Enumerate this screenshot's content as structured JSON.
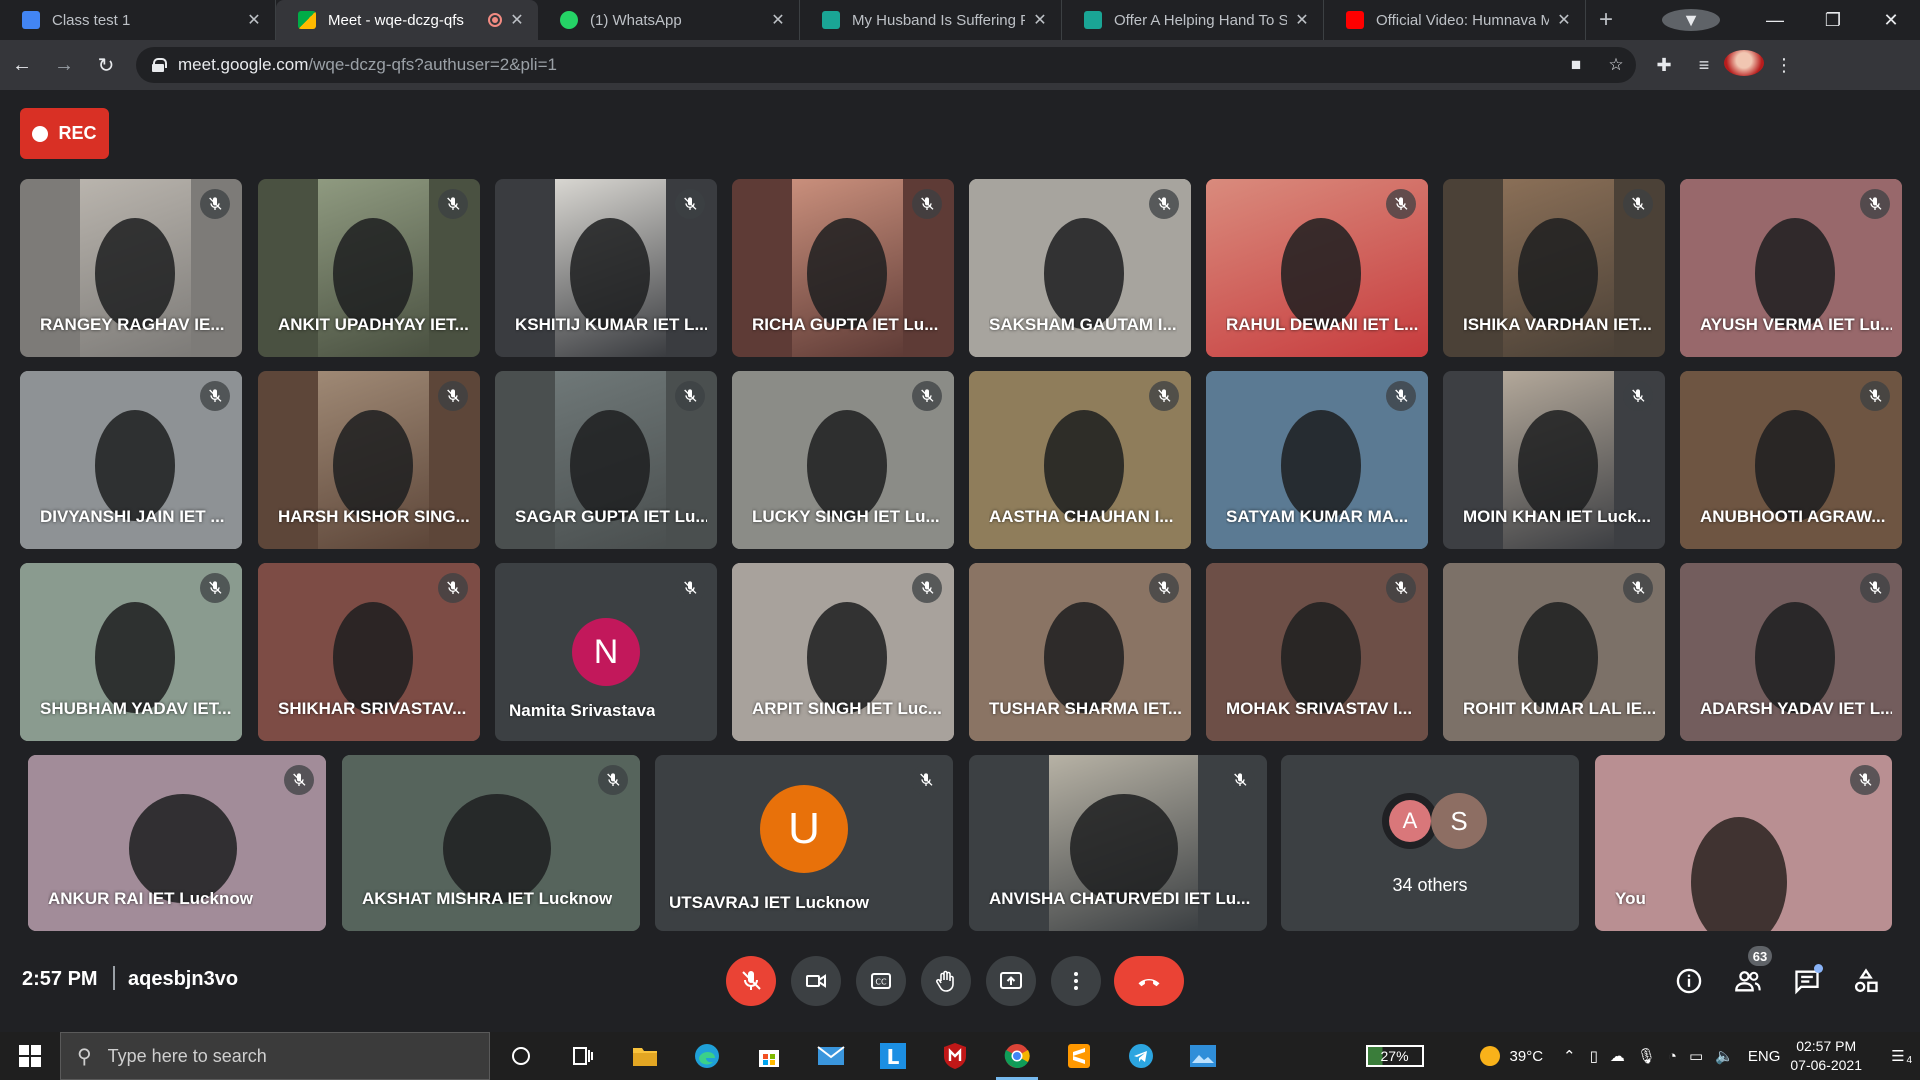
{
  "browser": {
    "tabs": [
      {
        "title": "Class test 1",
        "favicon_color": "#4285f4"
      },
      {
        "title": "Meet - wqe-dczg-qfs",
        "favicon_color": "#00ac47",
        "active": true
      },
      {
        "title": "(1) WhatsApp",
        "favicon_color": "#25d366"
      },
      {
        "title": "My Husband Is Suffering Fr",
        "favicon_color": "#1aa595"
      },
      {
        "title": "Offer A Helping Hand To Su",
        "favicon_color": "#1aa595"
      },
      {
        "title": "Official Video: Humnava Me",
        "favicon_color": "#ff0000"
      }
    ],
    "url_host": "meet.google.com",
    "url_path": "/wqe-dczg-qfs?authuser=2&pli=1"
  },
  "meet": {
    "rec_label": "REC",
    "participants": [
      {
        "name": "RANGEY RAGHAV IE...",
        "bg": "#7d7b78",
        "cam": "#b9b4ad"
      },
      {
        "name": "ANKIT UPADHYAY IET...",
        "bg": "#4a5141",
        "cam": "#8f9a80"
      },
      {
        "name": "KSHITIJ KUMAR IET L...",
        "bg": "#3a3c40",
        "cam": "#d8d6d1"
      },
      {
        "name": "RICHA GUPTA IET Lu...",
        "bg": "#5e3b36",
        "cam": "#c98f7c"
      },
      {
        "name": "SAKSHAM GAUTAM I...",
        "bg": "#a7a49e",
        "cam": "#a7a49e"
      },
      {
        "name": "RAHUL DEWANI IET L...",
        "bg": "#c73b3d",
        "cam": "#d98b7d"
      },
      {
        "name": "ISHIKA VARDHAN IET...",
        "bg": "#4b4137",
        "cam": "#8a6f57"
      },
      {
        "name": "AYUSH VERMA IET Lu...",
        "bg": "#98686b",
        "cam": "#98686b"
      },
      {
        "name": "DIVYANSHI JAIN IET ...",
        "bg": "#8e9295",
        "cam": "#8e9295"
      },
      {
        "name": "HARSH KISHOR SING...",
        "bg": "#5d4639",
        "cam": "#9f8975"
      },
      {
        "name": "SAGAR GUPTA IET Lu...",
        "bg": "#4a4f4f",
        "cam": "#6f7878"
      },
      {
        "name": "LUCKY SINGH IET Lu...",
        "bg": "#8b8c87",
        "cam": "#8b8c87"
      },
      {
        "name": "AASTHA CHAUHAN I...",
        "bg": "#8f7d5b",
        "cam": "#8f7d5b"
      },
      {
        "name": "SATYAM KUMAR MA...",
        "bg": "#5b7a93",
        "cam": "#5b7a93"
      },
      {
        "name": "MOIN KHAN IET Luck...",
        "bg": "#3d3f43",
        "cam": "#b3a89a"
      },
      {
        "name": "ANUBHOOTI AGRAW...",
        "bg": "#6e5542",
        "cam": "#6e5542"
      },
      {
        "name": "SHUBHAM YADAV IET...",
        "bg": "#8a9b8f",
        "cam": "#8a9b8f"
      },
      {
        "name": "SHIKHAR SRIVASTAV...",
        "bg": "#7d4c45",
        "cam": "#7d4c45"
      },
      {
        "name": "Namita Srivastava",
        "avatar": "N",
        "avatar_color": "#c2185b"
      },
      {
        "name": "ARPIT SINGH IET Luc...",
        "bg": "#a8a29c",
        "cam": "#a8a29c"
      },
      {
        "name": "TUSHAR SHARMA IET...",
        "bg": "#8a7464",
        "cam": "#8a7464"
      },
      {
        "name": "MOHAK SRIVASTAV I...",
        "bg": "#6d4f47",
        "cam": "#6d4f47"
      },
      {
        "name": "ROHIT KUMAR LAL IE...",
        "bg": "#7c7168",
        "cam": "#7c7168"
      },
      {
        "name": "ADARSH YADAV IET L...",
        "bg": "#735d5d",
        "cam": "#735d5d"
      },
      {
        "name": "ANKUR RAI IET Lucknow",
        "bg": "#a28c99",
        "cam": "#a28c99"
      },
      {
        "name": "AKSHAT MISHRA IET Lucknow",
        "bg": "#56645c",
        "cam": "#56645c"
      },
      {
        "name": "UTSAVRAJ IET Lucknow",
        "avatar": "U",
        "avatar_color": "#e8710a"
      },
      {
        "name": "ANVISHA CHATURVEDI IET Lu...",
        "bg": "#3c4043",
        "cam": "#b7b2a5"
      }
    ],
    "others": {
      "label": "34 others",
      "avatars": [
        {
          "letter": "A",
          "color": "#d9777a"
        },
        {
          "letter": "S",
          "color": "#8d6e63"
        }
      ]
    },
    "self": {
      "name": "You",
      "bg": "#b98f92"
    },
    "time": "2:57 PM",
    "meeting_code": "aqesbjn3vo",
    "participant_count": "63"
  },
  "taskbar": {
    "search_placeholder": "Type here to search",
    "battery": "27%",
    "weather": "39°C",
    "lang": "ENG",
    "time": "02:57 PM",
    "date": "07-06-2021",
    "notif_count": "4"
  }
}
